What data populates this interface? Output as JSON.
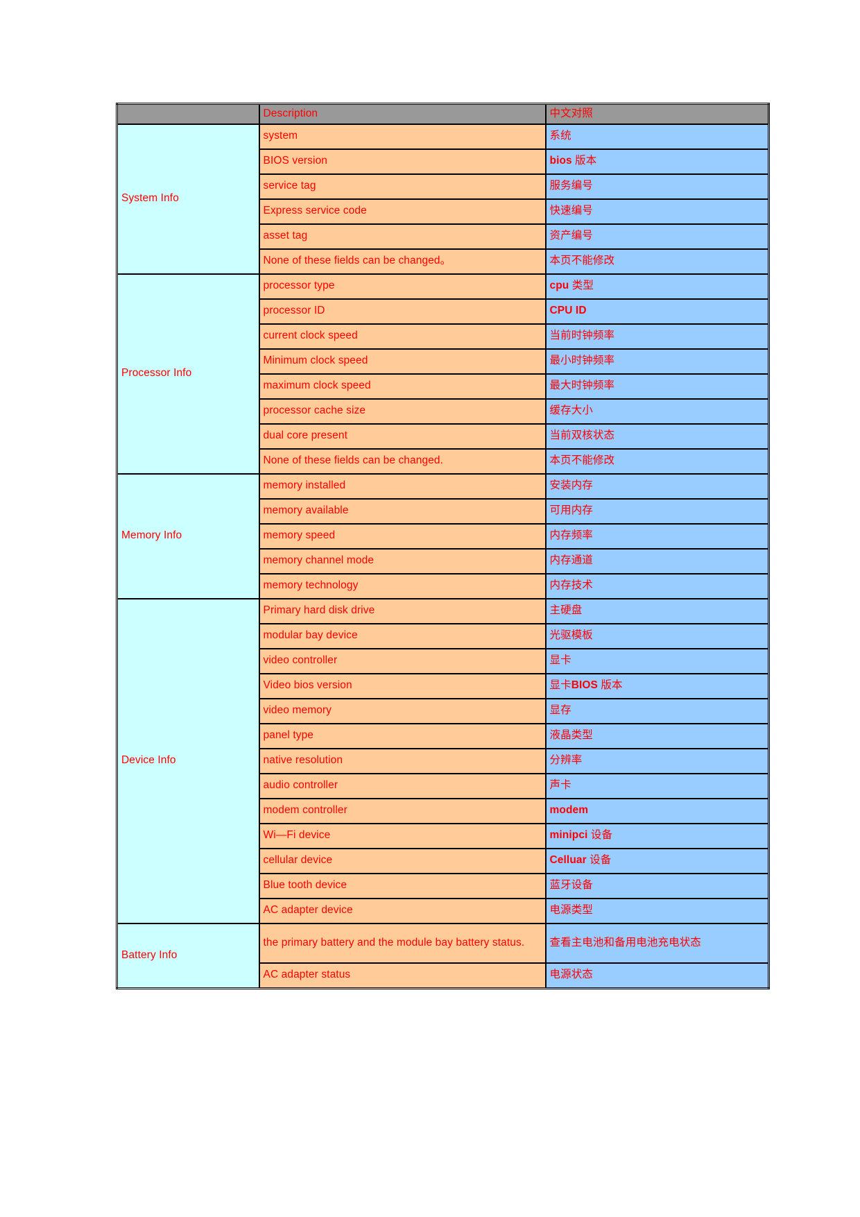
{
  "colors": {
    "text": "#ff0000",
    "header_bg": "#999999",
    "category_bg": "#ccffff",
    "description_bg": "#ffcc99",
    "chinese_bg": "#99ccff",
    "border": "#000000",
    "page_bg": "#ffffff"
  },
  "table": {
    "header": {
      "col1": "",
      "col2": "Description",
      "col3": "中文对照"
    },
    "sections": [
      {
        "category": "System Info",
        "rows": [
          {
            "description": "system",
            "chinese": "系统",
            "chinese_bold": ""
          },
          {
            "description": "BIOS version",
            "chinese": " 版本",
            "chinese_bold": "bios"
          },
          {
            "description": "service tag",
            "chinese": "服务编号",
            "chinese_bold": ""
          },
          {
            "description": "Express service code",
            "chinese": "快速编号",
            "chinese_bold": ""
          },
          {
            "description": "asset tag",
            "chinese": "资产编号",
            "chinese_bold": ""
          },
          {
            "description": "None of these fields can be changed。",
            "chinese": "本页不能修改",
            "chinese_bold": ""
          }
        ]
      },
      {
        "category": "Processor Info",
        "rows": [
          {
            "description": "processor type",
            "chinese": " 类型",
            "chinese_bold": "cpu"
          },
          {
            "description": "processor ID",
            "chinese": "",
            "chinese_bold": "CPU ID"
          },
          {
            "description": "current clock speed",
            "chinese": "当前时钟频率",
            "chinese_bold": ""
          },
          {
            "description": "Minimum clock speed",
            "chinese": "最小时钟频率",
            "chinese_bold": ""
          },
          {
            "description": "maximum clock speed",
            "chinese": "最大时钟频率",
            "chinese_bold": ""
          },
          {
            "description": "processor cache size",
            "chinese": "缓存大小",
            "chinese_bold": ""
          },
          {
            "description": "dual core present",
            "chinese": "当前双核状态",
            "chinese_bold": ""
          },
          {
            "description": "None of these fields can be changed.",
            "chinese": "本页不能修改",
            "chinese_bold": ""
          }
        ]
      },
      {
        "category": "Memory Info",
        "rows": [
          {
            "description": "memory installed",
            "chinese": "安装内存",
            "chinese_bold": ""
          },
          {
            "description": "memory available",
            "chinese": "可用内存",
            "chinese_bold": ""
          },
          {
            "description": "memory speed",
            "chinese": "内存频率",
            "chinese_bold": ""
          },
          {
            "description": "memory channel mode",
            "chinese": "内存通道",
            "chinese_bold": ""
          },
          {
            "description": "memory technology",
            "chinese": "内存技术",
            "chinese_bold": ""
          }
        ]
      },
      {
        "category": "Device Info",
        "rows": [
          {
            "description": "Primary hard disk drive",
            "chinese": "主硬盘",
            "chinese_bold": ""
          },
          {
            "description": "modular bay device",
            "chinese": "光驱模板",
            "chinese_bold": ""
          },
          {
            "description": "video controller",
            "chinese": "显卡",
            "chinese_bold": ""
          },
          {
            "description": "Video bios version",
            "chinese_prefix": "显卡",
            "chinese_bold": "BIOS",
            "chinese": " 版本"
          },
          {
            "description": "video memory",
            "chinese": "显存",
            "chinese_bold": ""
          },
          {
            "description": "panel type",
            "chinese": "液晶类型",
            "chinese_bold": ""
          },
          {
            "description": "native resolution",
            "chinese": "分辨率",
            "chinese_bold": ""
          },
          {
            "description": "audio controller",
            "chinese": "声卡",
            "chinese_bold": ""
          },
          {
            "description": "modem controller",
            "chinese": "",
            "chinese_bold": "modem"
          },
          {
            "description": "Wi—Fi device",
            "chinese": " 设备",
            "chinese_bold": "minipci"
          },
          {
            "description": "cellular device",
            "chinese": " 设备",
            "chinese_bold": "Celluar"
          },
          {
            "description": "Blue tooth device",
            "chinese": "蓝牙设备",
            "chinese_bold": ""
          },
          {
            "description": "AC adapter device",
            "chinese": "电源类型",
            "chinese_bold": ""
          }
        ]
      },
      {
        "category": "Battery Info",
        "rows": [
          {
            "description": "the primary battery and the module bay battery status.",
            "chinese": "查看主电池和备用电池充电状态",
            "chinese_bold": "",
            "tall": true
          },
          {
            "description": "AC adapter status",
            "chinese": "电源状态",
            "chinese_bold": ""
          }
        ]
      }
    ]
  }
}
